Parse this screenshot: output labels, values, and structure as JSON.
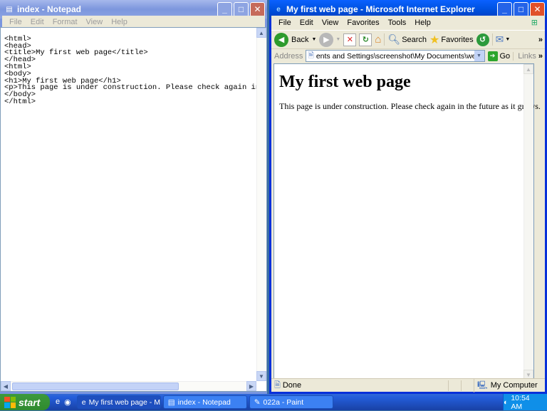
{
  "notepad": {
    "title": "index - Notepad",
    "menu": [
      "File",
      "Edit",
      "Format",
      "View",
      "Help"
    ],
    "lines": [
      "<html>",
      "<head>",
      "<title>My first web page</title>",
      "</head>",
      "<html>",
      "<body>",
      "<h1>My first web page</h1>",
      "<p>This page is under construction. Please check again in t",
      "</body>",
      "</html>"
    ]
  },
  "ie": {
    "title": "My first web page - Microsoft Internet Explorer",
    "menu": [
      "File",
      "Edit",
      "View",
      "Favorites",
      "Tools",
      "Help"
    ],
    "toolbar": {
      "back": "Back",
      "search": "Search",
      "favorites": "Favorites"
    },
    "address_label": "Address",
    "address_value": "ents and Settings\\screenshot\\My Documents\\website\\index.htm",
    "go_label": "Go",
    "links_label": "Links",
    "page": {
      "heading": "My first web page",
      "paragraph": "This page is under construction. Please check again in the future as it grows."
    },
    "status": {
      "left": "Done",
      "zone": "My Computer"
    }
  },
  "taskbar": {
    "start_label": "start",
    "tasks": [
      {
        "label": "My first web page - M..."
      },
      {
        "label": "index - Notepad"
      },
      {
        "label": "022a - Paint"
      }
    ],
    "clock": "10:54 AM"
  },
  "colors": {
    "ie_title": "#0054e3",
    "notepad_title_inactive": "#7c96dd",
    "desktop": "#3a6ea5",
    "start": "#2f8a2f"
  }
}
